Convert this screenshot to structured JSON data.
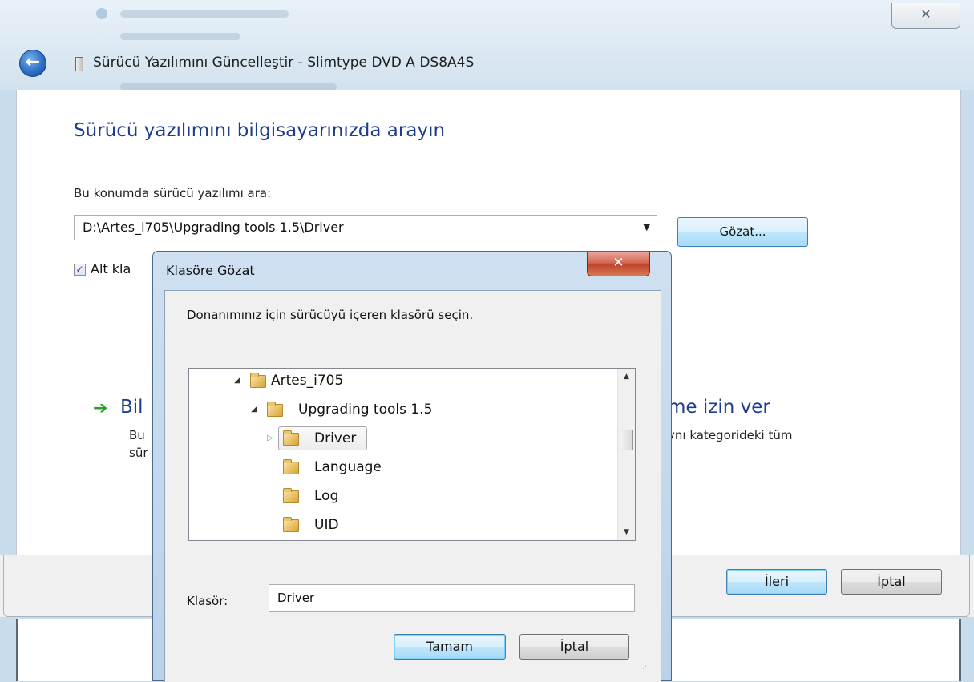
{
  "main_window": {
    "title": "Sürücü Yazılımını Güncelleştir - Slimtype DVD A  DS8A4S",
    "close_glyph": "✕",
    "back_glyph": "←",
    "heading": "Sürücü yazılımını bilgisayarınızda arayın",
    "location_label": "Bu konumda sürücü yazılımı ara:",
    "location_value": "D:\\Artes_i705\\Upgrading tools 1.5\\Driver",
    "combo_arrow": "▼",
    "browse_button": "Gözat...",
    "subfolders_checkbox_label": "Alt kla",
    "subfolders_checked": true,
    "option_arrow": "➔",
    "option_title_left": "Bil",
    "option_desc_left_1": "Bu",
    "option_desc_left_2": "sür",
    "option_title_right": "me izin ver",
    "option_desc_right": "ynı kategorideki tüm",
    "next_button": "İleri",
    "cancel_button": "İptal"
  },
  "browse_dialog": {
    "title": "Klasöre Gözat",
    "close_glyph": "✕",
    "description": "Donanımınız için sürücüyü içeren klasörü seçin.",
    "tree": [
      {
        "label": "Artes_i705",
        "expander": "◢"
      },
      {
        "label": "Upgrading tools 1.5",
        "expander": "◢"
      },
      {
        "label": "Driver",
        "expander": "▷",
        "selected": true
      },
      {
        "label": "Language",
        "expander": ""
      },
      {
        "label": "Log",
        "expander": ""
      },
      {
        "label": "UID",
        "expander": ""
      }
    ],
    "scroll_up": "▲",
    "scroll_down": "▼",
    "folder_label": "Klasör:",
    "folder_value": "Driver",
    "ok_button": "Tamam",
    "cancel_button": "İptal",
    "grip": "⋰"
  },
  "colors": {
    "heading_blue": "#1e3c8a",
    "green_arrow": "#2f9e2f",
    "close_red": "#c1452b"
  }
}
